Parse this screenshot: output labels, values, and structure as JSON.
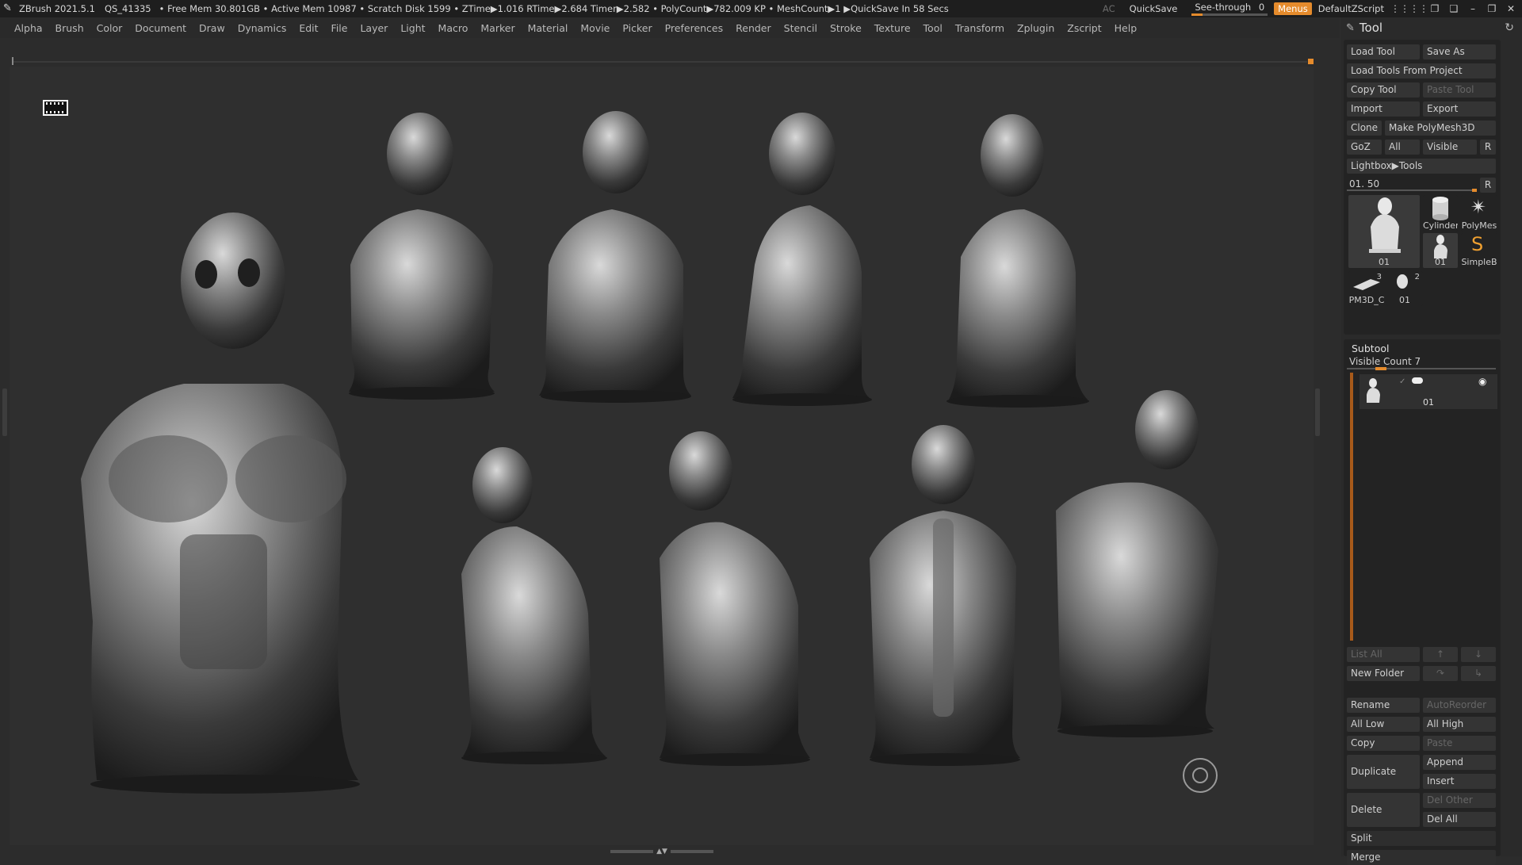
{
  "titlebar": {
    "app": "ZBrush 2021.5.1",
    "document": "QS_41335",
    "status": "• Free Mem 30.801GB • Active Mem 10987 • Scratch Disk 1599 • ZTime▶1.016 RTime▶2.684 Timer▶2.582 • PolyCount▶782.009 KP • MeshCount▶1 ▶QuickSave In 58 Secs",
    "ac": "AC",
    "quicksave": "QuickSave",
    "see_through_label": "See-through",
    "see_through_value": "0",
    "menus": "Menus",
    "script": "DefaultZScript",
    "accent": "#e58b2c"
  },
  "menubar": [
    "Alpha",
    "Brush",
    "Color",
    "Document",
    "Draw",
    "Dynamics",
    "Edit",
    "File",
    "Layer",
    "Light",
    "Macro",
    "Marker",
    "Material",
    "Movie",
    "Picker",
    "Preferences",
    "Render",
    "Stencil",
    "Stroke",
    "Texture",
    "Tool",
    "Transform",
    "Zplugin",
    "Zscript",
    "Help"
  ],
  "canvas": {
    "film_icon": "film-strip-icon",
    "gizmo_icon": "navigation-circle-icon"
  },
  "panel": {
    "title": "Tool",
    "load_tool": "Load Tool",
    "save_as": "Save As",
    "load_from_project": "Load Tools From Project",
    "copy_tool": "Copy Tool",
    "paste_tool": "Paste Tool",
    "import": "Import",
    "export": "Export",
    "clone": "Clone",
    "make_polymesh": "Make PolyMesh3D",
    "goz": "GoZ",
    "all": "All",
    "visible": "Visible",
    "r": "R",
    "lightbox_tools": "Lightbox▶Tools",
    "tool_slider": "01. 50",
    "thumbs": {
      "main": "01",
      "cylinder": "Cylinder",
      "polymesh": "PolyMes",
      "figure": "01",
      "simpleb": "SimpleB",
      "pm3d": "PM3D_C",
      "pm3d_num": "3",
      "head": "01",
      "head_num": "2"
    },
    "subtool": {
      "title": "Subtool",
      "visible_count": "Visible Count 7",
      "item_name": "01",
      "list_all": "List All",
      "new_folder": "New Folder",
      "rename": "Rename",
      "auto_reorder": "AutoReorder",
      "all_low": "All Low",
      "all_high": "All High",
      "copy": "Copy",
      "paste": "Paste",
      "duplicate": "Duplicate",
      "append": "Append",
      "insert": "Insert",
      "delete": "Delete",
      "del_other": "Del Other",
      "del_all": "Del All",
      "split": "Split",
      "merge": "Merge"
    }
  }
}
